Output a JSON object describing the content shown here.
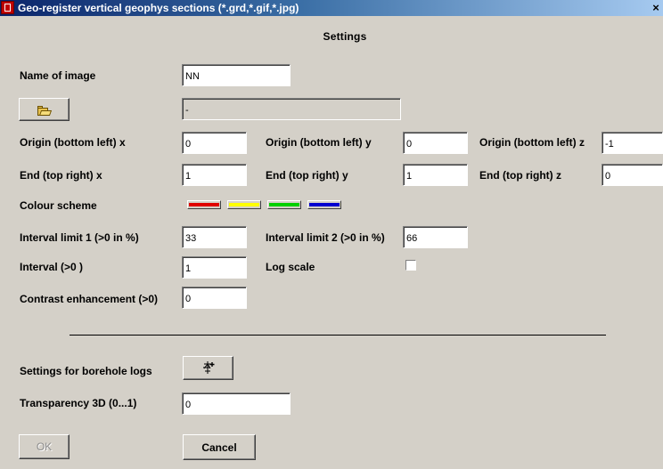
{
  "window": {
    "title": "Geo-register vertical geophys sections (*.grd,*.gif,*.jpg)",
    "close_glyph": "×",
    "app_icon": "app-logo-icon"
  },
  "dialog": {
    "heading": "Settings"
  },
  "name_of_image": {
    "label": "Name of image",
    "value": "NN"
  },
  "file": {
    "button_icon": "open-folder-icon",
    "path_value": "-"
  },
  "origin": {
    "x_label": "Origin (bottom left) x",
    "x_value": "0",
    "y_label": "Origin (bottom left) y",
    "y_value": "0",
    "z_label": "Origin (bottom left) z",
    "z_value": "-1"
  },
  "end": {
    "x_label": "End (top right) x",
    "x_value": "1",
    "y_label": "End (top right) y",
    "y_value": "1",
    "z_label": "End (top right) z",
    "z_value": "0"
  },
  "colour_scheme": {
    "label": "Colour scheme",
    "colors": [
      "#e00000",
      "#ffff00",
      "#00d000",
      "#0000d0"
    ]
  },
  "interval_limit_1": {
    "label": "Interval limit 1 (>0 in %)",
    "value": "33"
  },
  "interval_limit_2": {
    "label": "Interval limit 2 (>0 in %)",
    "value": "66"
  },
  "interval": {
    "label": "Interval (>0 )",
    "value": "1"
  },
  "log_scale": {
    "label": "Log scale",
    "checked": false
  },
  "contrast": {
    "label": "Contrast enhancement (>0)",
    "value": "0"
  },
  "borehole": {
    "label": "Settings for borehole logs",
    "button_icon": "borehole-settings-icon"
  },
  "transparency": {
    "label": "Transparency 3D (0...1)",
    "value": "0"
  },
  "buttons": {
    "ok": "OK",
    "cancel": "Cancel"
  }
}
